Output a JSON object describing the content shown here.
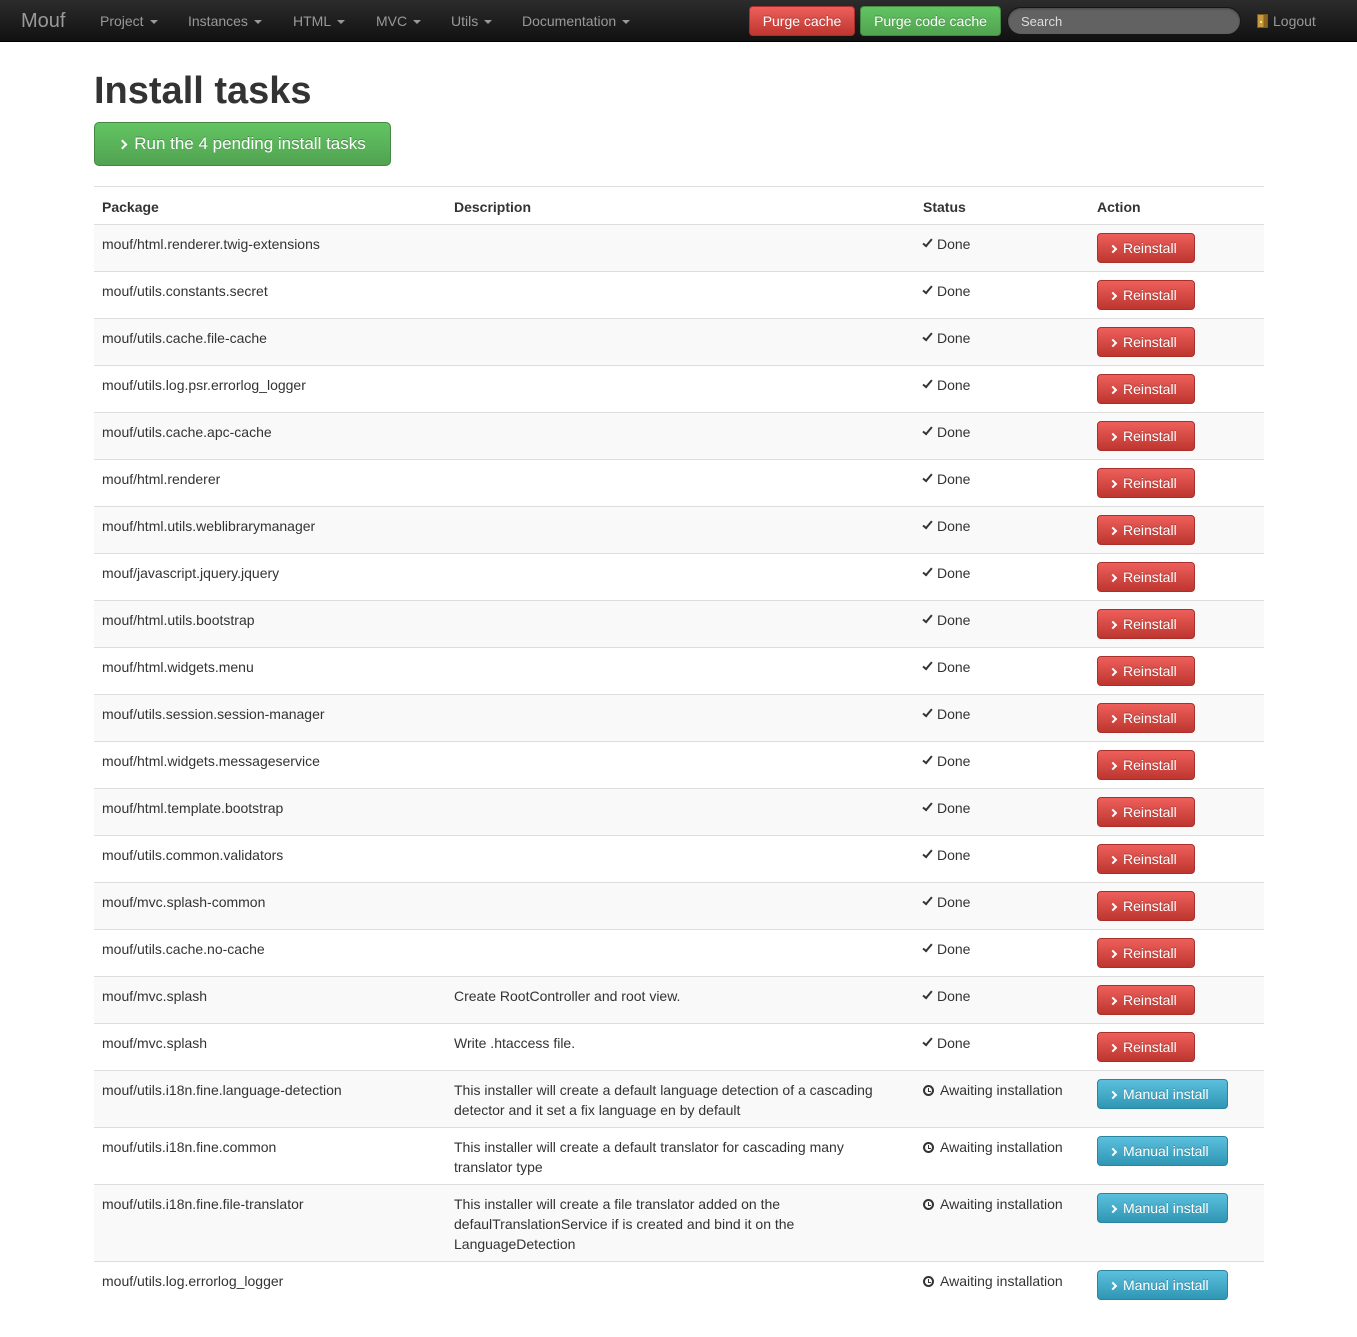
{
  "navbar": {
    "brand": "Mouf",
    "menu": [
      {
        "label": "Project"
      },
      {
        "label": "Instances"
      },
      {
        "label": "HTML"
      },
      {
        "label": "MVC"
      },
      {
        "label": "Utils"
      },
      {
        "label": "Documentation"
      }
    ],
    "purge_cache_label": "Purge cache",
    "purge_code_cache_label": "Purge code cache",
    "search_placeholder": "Search",
    "logout_label": "Logout"
  },
  "page": {
    "title": "Install tasks",
    "run_button_label": "Run the 4 pending install tasks"
  },
  "table": {
    "headers": {
      "package": "Package",
      "description": "Description",
      "status": "Status",
      "action": "Action"
    },
    "rows": [
      {
        "package": "mouf/html.renderer.twig-extensions",
        "description": "",
        "status": "Done",
        "action": "Reinstall"
      },
      {
        "package": "mouf/utils.constants.secret",
        "description": "",
        "status": "Done",
        "action": "Reinstall"
      },
      {
        "package": "mouf/utils.cache.file-cache",
        "description": "",
        "status": "Done",
        "action": "Reinstall"
      },
      {
        "package": "mouf/utils.log.psr.errorlog_logger",
        "description": "",
        "status": "Done",
        "action": "Reinstall"
      },
      {
        "package": "mouf/utils.cache.apc-cache",
        "description": "",
        "status": "Done",
        "action": "Reinstall"
      },
      {
        "package": "mouf/html.renderer",
        "description": "",
        "status": "Done",
        "action": "Reinstall"
      },
      {
        "package": "mouf/html.utils.weblibrarymanager",
        "description": "",
        "status": "Done",
        "action": "Reinstall"
      },
      {
        "package": "mouf/javascript.jquery.jquery",
        "description": "",
        "status": "Done",
        "action": "Reinstall"
      },
      {
        "package": "mouf/html.utils.bootstrap",
        "description": "",
        "status": "Done",
        "action": "Reinstall"
      },
      {
        "package": "mouf/html.widgets.menu",
        "description": "",
        "status": "Done",
        "action": "Reinstall"
      },
      {
        "package": "mouf/utils.session.session-manager",
        "description": "",
        "status": "Done",
        "action": "Reinstall"
      },
      {
        "package": "mouf/html.widgets.messageservice",
        "description": "",
        "status": "Done",
        "action": "Reinstall"
      },
      {
        "package": "mouf/html.template.bootstrap",
        "description": "",
        "status": "Done",
        "action": "Reinstall"
      },
      {
        "package": "mouf/utils.common.validators",
        "description": "",
        "status": "Done",
        "action": "Reinstall"
      },
      {
        "package": "mouf/mvc.splash-common",
        "description": "",
        "status": "Done",
        "action": "Reinstall"
      },
      {
        "package": "mouf/utils.cache.no-cache",
        "description": "",
        "status": "Done",
        "action": "Reinstall"
      },
      {
        "package": "mouf/mvc.splash",
        "description": "Create RootController and root view.",
        "status": "Done",
        "action": "Reinstall"
      },
      {
        "package": "mouf/mvc.splash",
        "description": "Write .htaccess file.",
        "status": "Done",
        "action": "Reinstall"
      },
      {
        "package": "mouf/utils.i18n.fine.language-detection",
        "description": "This installer will create a default language detection of a cascading detector and it set a fix language en by default",
        "status": "Awaiting installation",
        "action": "Manual install"
      },
      {
        "package": "mouf/utils.i18n.fine.common",
        "description": "This installer will create a default translator for cascading many translator type",
        "status": "Awaiting installation",
        "action": "Manual install"
      },
      {
        "package": "mouf/utils.i18n.fine.file-translator",
        "description": "This installer will create a file translator added on the defaulTranslationService if is created and bind it on the LanguageDetection",
        "status": "Awaiting installation",
        "action": "Manual install"
      },
      {
        "package": "mouf/utils.log.errorlog_logger",
        "description": "",
        "status": "Awaiting installation",
        "action": "Manual install"
      }
    ]
  },
  "colors": {
    "danger": "#bd362f",
    "success": "#51a351",
    "info": "#2f96b4",
    "navbar": "#1b1b1b"
  }
}
